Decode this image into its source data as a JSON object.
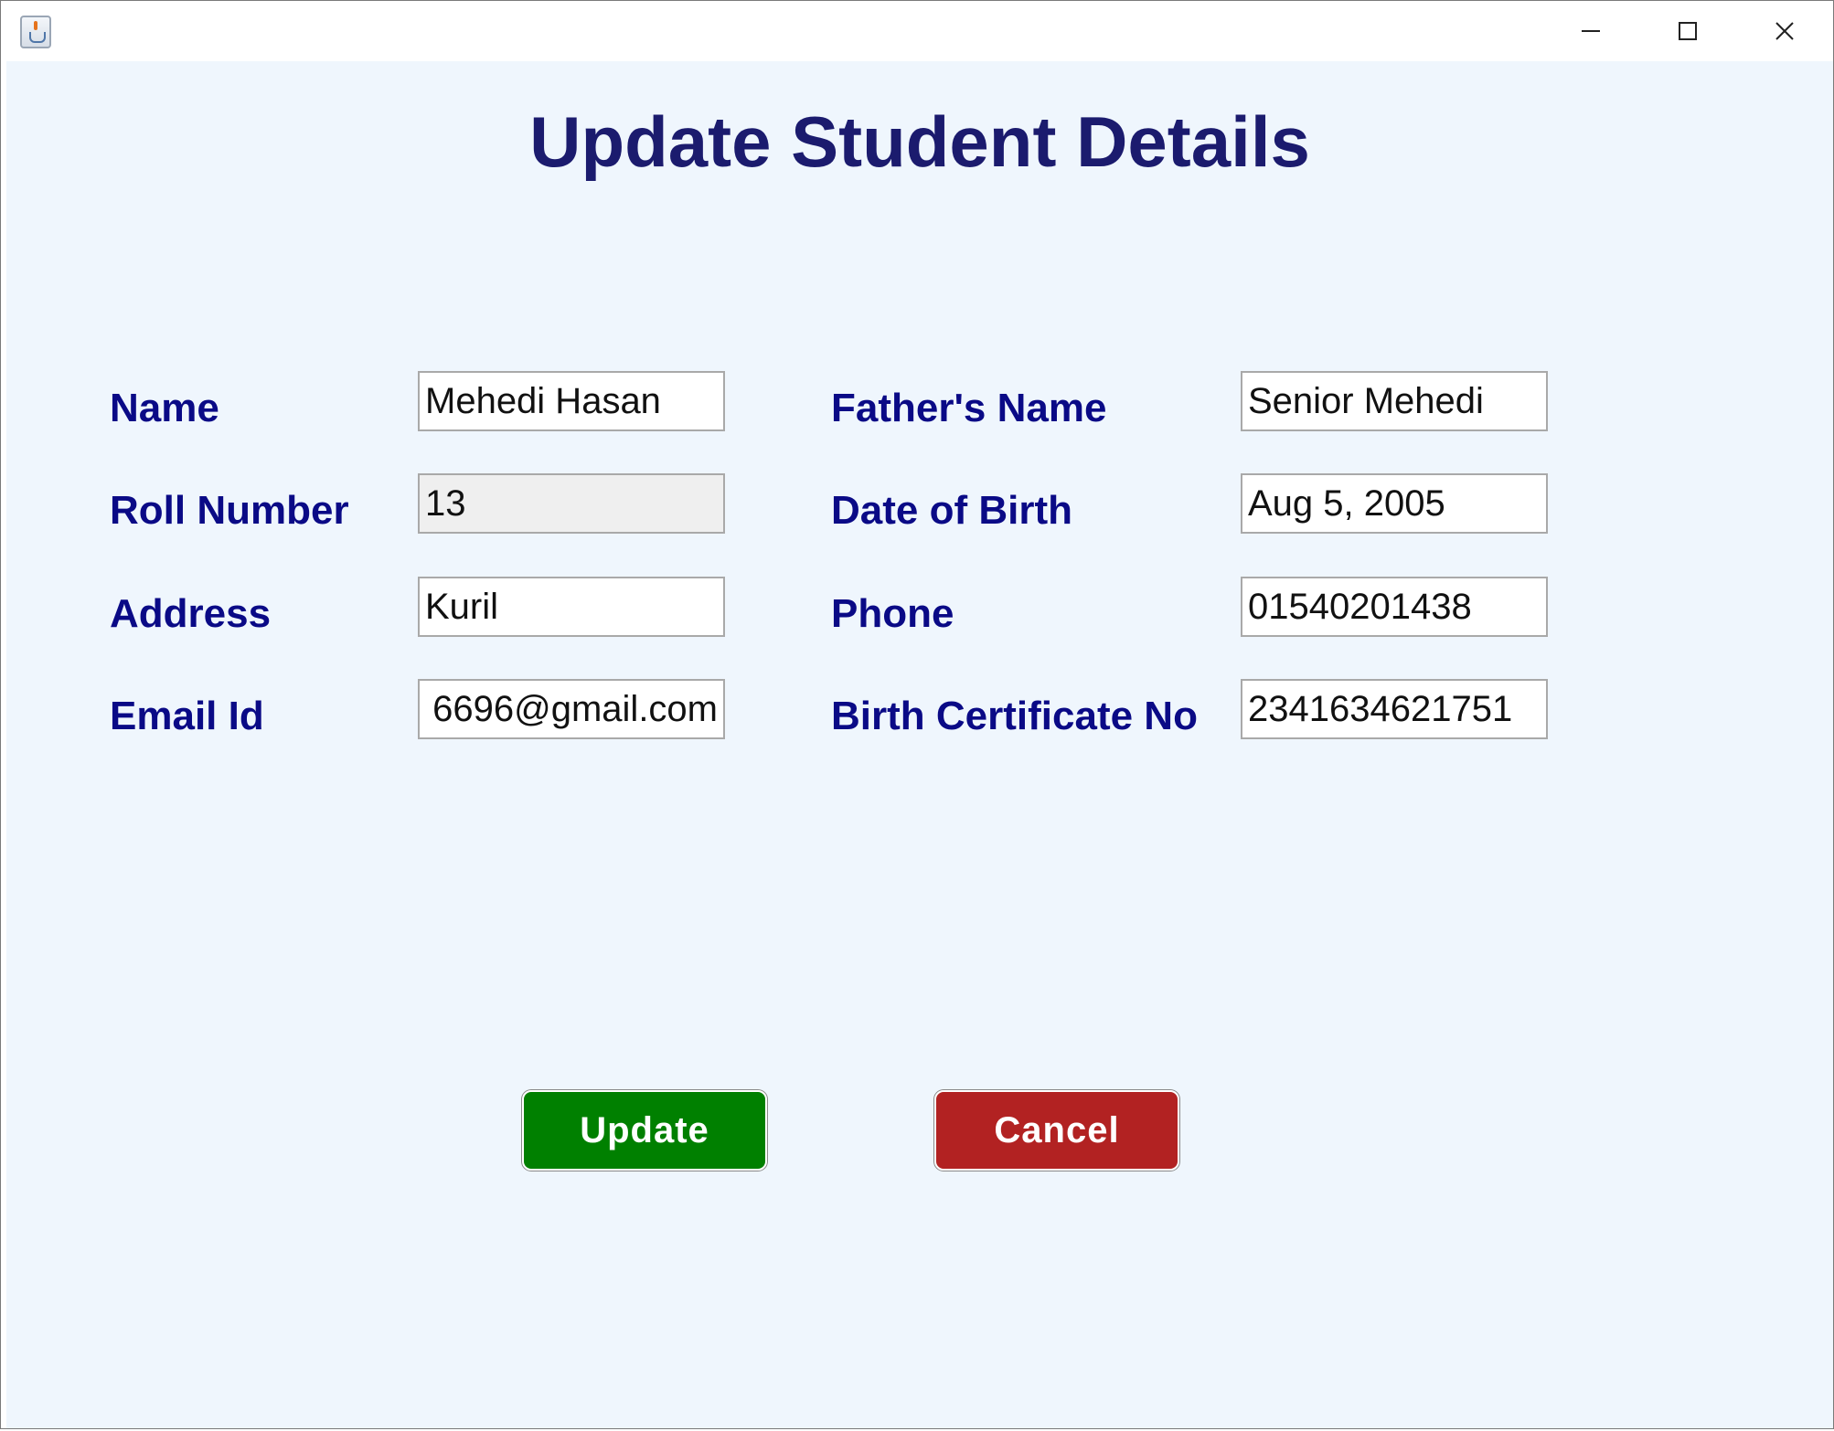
{
  "window": {
    "title": "",
    "controls": {
      "minimize_icon": "minimize-icon",
      "maximize_icon": "maximize-icon",
      "close_icon": "close-icon"
    }
  },
  "page": {
    "title": "Update Student Details"
  },
  "form": {
    "name": {
      "label": "Name",
      "value": "Mehedi Hasan"
    },
    "fathers_name": {
      "label": "Father's Name",
      "value": "Senior Mehedi"
    },
    "roll_number": {
      "label": "Roll Number",
      "value": "13"
    },
    "date_of_birth": {
      "label": "Date of Birth",
      "value": "Aug 5, 2005"
    },
    "address": {
      "label": "Address",
      "value": "Kuril"
    },
    "phone": {
      "label": "Phone",
      "value": "01540201438"
    },
    "email": {
      "label": "Email Id",
      "value": "6696@gmail.com"
    },
    "birth_certificate": {
      "label": "Birth Certificate No",
      "value": "2341634621751"
    }
  },
  "actions": {
    "update_label": "Update",
    "cancel_label": "Cancel"
  },
  "colors": {
    "title": "#1b1b6e",
    "label": "#0a0a86",
    "background": "#eff6fd",
    "update_button": "#008000",
    "cancel_button": "#b22222"
  }
}
